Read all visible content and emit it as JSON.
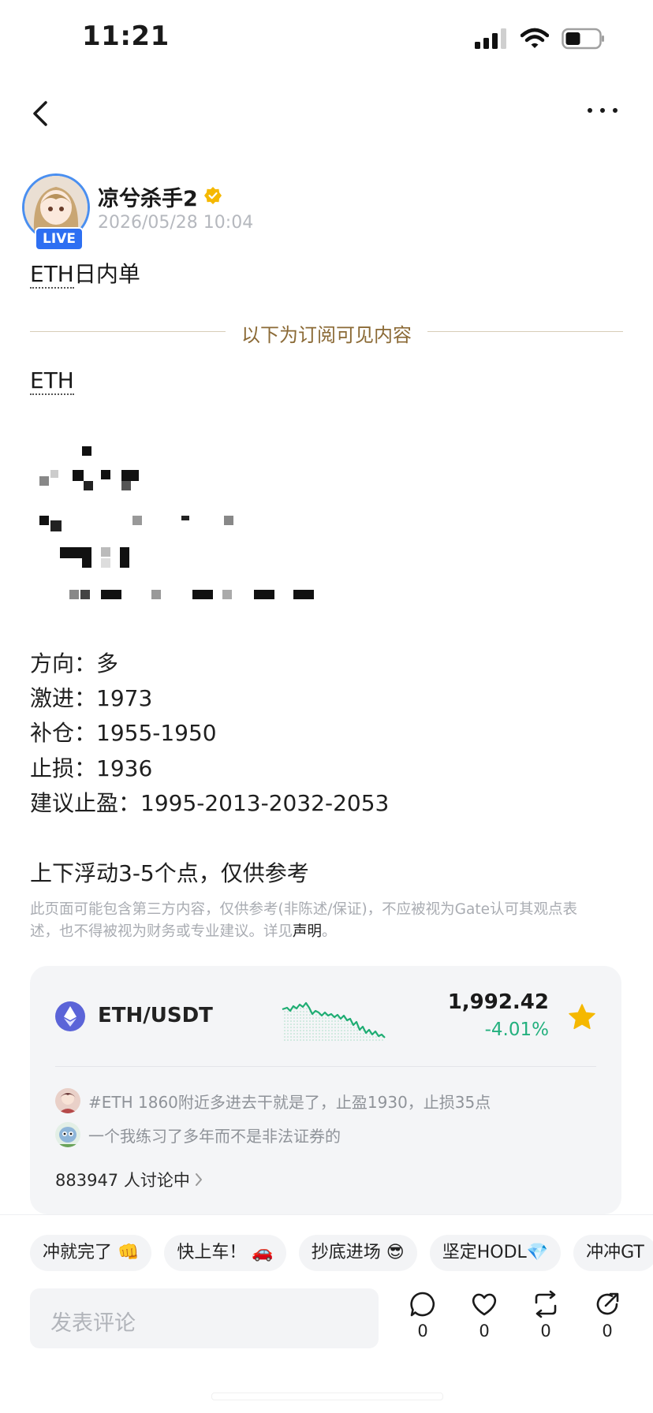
{
  "status_bar": {
    "time": "11:21"
  },
  "author": {
    "name": "凉兮杀手2",
    "live_label": "LIVE",
    "post_time": "2026/05/28 10:04"
  },
  "post": {
    "title_ticker": "ETH",
    "title_suffix": "日内单",
    "subscriber_divider": "以下为订阅可见内容",
    "ticker": "ETH",
    "lines": [
      "方向：多",
      "激进：1973",
      "补仓：1955-1950",
      "止损：1936",
      "建议止盈：1995-2013-2032-2053"
    ],
    "note": "上下浮动3-5个点，仅供参考",
    "disclaimer_text": "此页面可能包含第三方内容，仅供参考(非陈述/保证)，不应被视为Gate认可其观点表述，也不得被视为财务或专业建议。详见",
    "disclaimer_link": "声明",
    "disclaimer_end": "。"
  },
  "ticker_card": {
    "pair": "ETH/USDT",
    "price": "1,992.42",
    "change": "-4.01%",
    "change_color": "#23b07e",
    "comments": [
      "#ETH 1860附近多进去干就是了，止盈1930，止损35点",
      "一个我练习了多年而不是非法证券的"
    ],
    "discussion_count": "883947 人讨论中"
  },
  "quick_replies": [
    "冲就完了 👊",
    "快上车！ 🚗",
    "抄底进场 😎",
    "坚定HODL💎",
    "冲冲GT"
  ],
  "comment_input": {
    "placeholder": "发表评论"
  },
  "actions": [
    {
      "icon": "comment-icon",
      "count": "0"
    },
    {
      "icon": "heart-icon",
      "count": "0"
    },
    {
      "icon": "repost-icon",
      "count": "0"
    },
    {
      "icon": "share-icon",
      "count": "0"
    }
  ],
  "colors": {
    "accent_gold": "#8b6a36",
    "live_blue": "#2e6ff2",
    "positive_green": "#23b07e",
    "star_yellow": "#f5b800"
  }
}
